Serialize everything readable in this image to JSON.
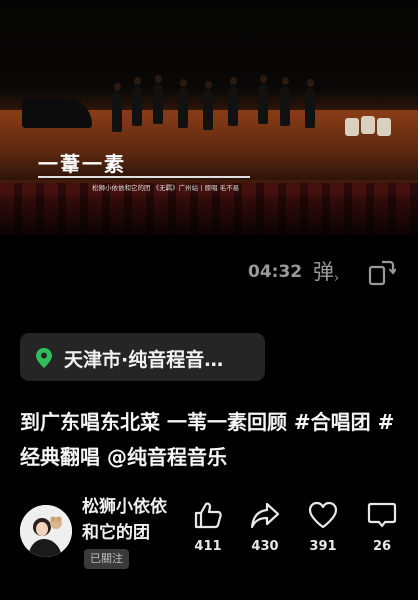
{
  "video": {
    "overlay_title": "一葦一素",
    "overlay_subtitle": "松狮小依依和它的团 《无羁》广州站丨原唱 毛不易"
  },
  "player": {
    "duration": "04:32",
    "danmu_label": "弹",
    "danmu_icon": "danmu-toggle-icon",
    "rotate_icon": "rotate-screen-icon"
  },
  "location": {
    "icon": "location-pin-icon",
    "label": "天津市·纯音程音…",
    "accent": "#2fbf5a"
  },
  "post": {
    "description": "到广东唱东北菜  一苇一素回顾 #合唱团 #经典翻唱 @纯音程音乐"
  },
  "author": {
    "name": "松狮小依依和它的团",
    "follow_label": "已關注"
  },
  "actions": [
    {
      "icon": "thumbs-up-icon",
      "count": "411"
    },
    {
      "icon": "share-icon",
      "count": "430"
    },
    {
      "icon": "heart-icon",
      "count": "391"
    },
    {
      "icon": "comment-icon",
      "count": "26"
    }
  ]
}
